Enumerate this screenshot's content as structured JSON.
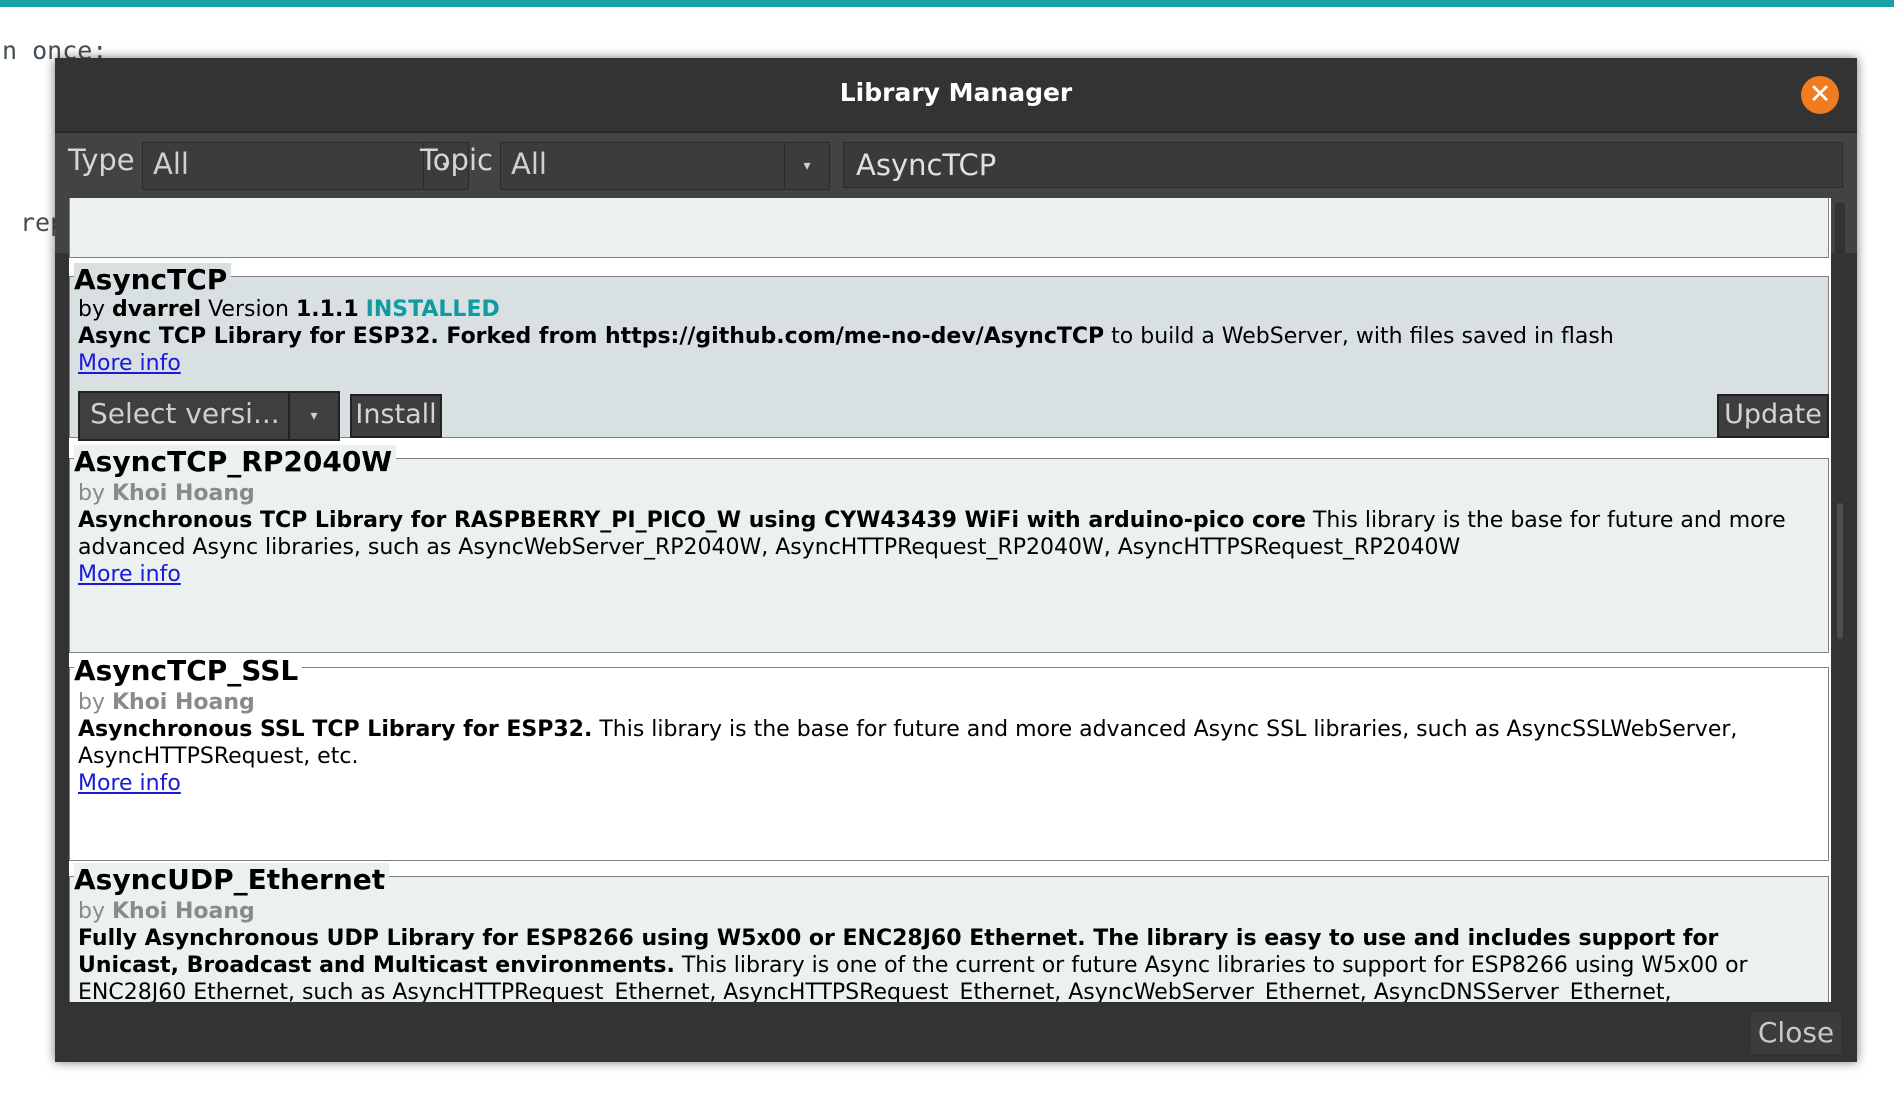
{
  "background": {
    "code_line_1": "n once:",
    "code_line_2": "rep"
  },
  "dialog": {
    "title": "Library Manager",
    "close_icon_glyph": "✕"
  },
  "filters": {
    "type_label": "Type",
    "type_value": "All",
    "topic_label": "Topic",
    "topic_value": "All",
    "search_value": "AsyncTCP",
    "dropdown_glyph": "▾"
  },
  "libraries": [
    {
      "name": "AsyncTCP",
      "by": "by",
      "author": "dvarrel",
      "version_label": "Version",
      "version": "1.1.1",
      "status": "INSTALLED",
      "desc_bold": "Async TCP Library for ESP32. Forked from https://github.com/me-no-dev/AsyncTCP",
      "desc_rest": " to build a WebServer, with files saved in flash",
      "more_info": "More info",
      "select_version": "Select versi...",
      "install": "Install",
      "update": "Update"
    },
    {
      "name": "AsyncTCP_RP2040W",
      "by": "by",
      "author": "Khoi Hoang",
      "desc_bold": "Asynchronous TCP Library for RASPBERRY_PI_PICO_W using CYW43439 WiFi with arduino-pico core",
      "desc_rest": " This library is the base for future and more",
      "desc_line2": "advanced Async libraries, such as AsyncWebServer_RP2040W, AsyncHTTPRequest_RP2040W, AsyncHTTPSRequest_RP2040W",
      "more_info": "More info"
    },
    {
      "name": "AsyncTCP_SSL",
      "by": "by",
      "author": "Khoi Hoang",
      "desc_bold": "Asynchronous SSL TCP Library for ESP32.",
      "desc_rest": " This library is the base for future and more advanced Async SSL libraries, such as AsyncSSLWebServer,",
      "desc_line2": "AsyncHTTPSRequest, etc.",
      "more_info": "More info"
    },
    {
      "name": "AsyncUDP_Ethernet",
      "by": "by",
      "author": "Khoi Hoang",
      "desc_bold_line1": "Fully Asynchronous UDP Library for ESP8266 using W5x00 or ENC28J60 Ethernet. The library is easy to use and includes support for",
      "desc_bold_line2": "Unicast, Broadcast and Multicast environments.",
      "desc_rest_line2": " This library is one of the current or future Async libraries to support for ESP8266 using W5x00 or",
      "desc_line3": "ENC28J60 Ethernet, such as AsyncHTTPRequest_Ethernet, AsyncHTTPSRequest_Ethernet, AsyncWebServer_Ethernet, AsyncDNSServer_Ethernet,"
    }
  ],
  "footer": {
    "close": "Close"
  },
  "colors": {
    "accent_teal": "#17a1a5",
    "dialog_bg": "#333333",
    "close_orange": "#f07c1f",
    "installed_teal": "#0f9ba0",
    "link_blue": "#1a1ad6"
  }
}
